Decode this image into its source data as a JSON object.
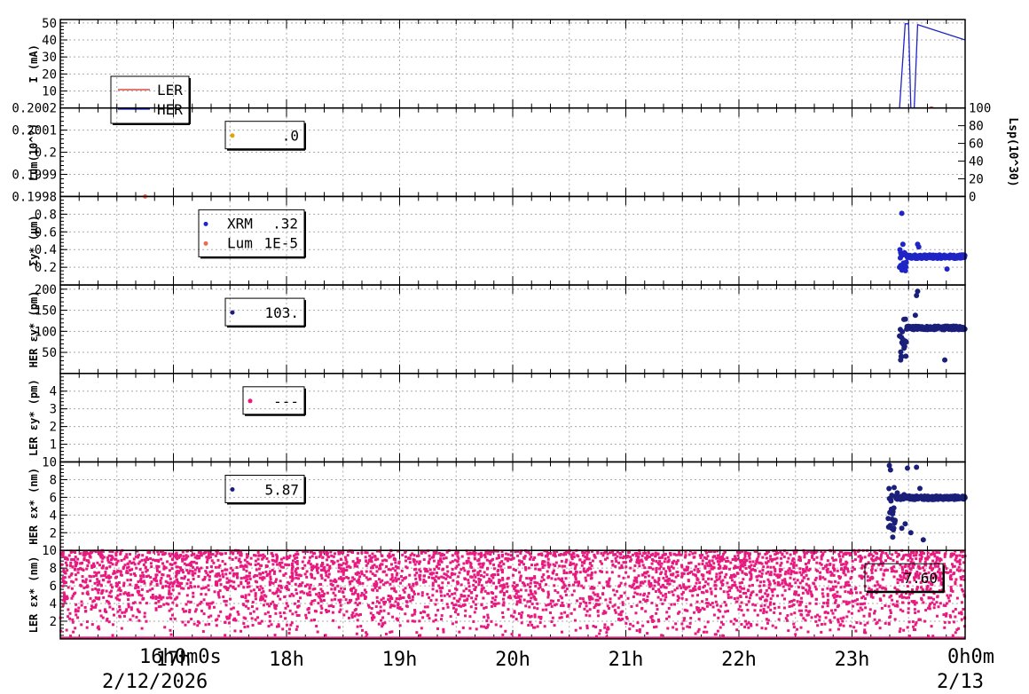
{
  "time_axis": {
    "start_label": "16h0m0s",
    "start_date": "2/12/2026",
    "end_label": "0h0m",
    "end_date": "2/13",
    "ticks": [
      "17h",
      "18h",
      "19h",
      "20h",
      "21h",
      "22h",
      "23h"
    ]
  },
  "chart_data": [
    {
      "id": "current",
      "type": "line",
      "ylabel": "I (mA)",
      "ylim": [
        0,
        52
      ],
      "yticks": [
        "10",
        "20",
        "30",
        "40",
        "50"
      ],
      "legend": [
        {
          "name": "LER",
          "color": "#d62a1e"
        },
        {
          "name": "HER",
          "color": "#1f24c6"
        }
      ],
      "series": [
        {
          "name": "LER",
          "color": "#d62a1e",
          "x": [
            16.0,
            23.68,
            23.7,
            23.73,
            24.0
          ],
          "y": [
            0,
            0,
            0.6,
            0,
            0
          ]
        },
        {
          "name": "HER",
          "color": "#1f24c6",
          "x": [
            16.0,
            23.42,
            23.47,
            23.5,
            23.52,
            23.55,
            23.58,
            24.0
          ],
          "y": [
            0,
            0,
            49.5,
            49.5,
            0,
            0,
            49,
            40
          ]
        }
      ]
    },
    {
      "id": "luminosity",
      "type": "scatter",
      "ylabel": "Lum(10^?)",
      "ylim": [
        0.1998,
        0.2002
      ],
      "yticks": [
        "0.1998",
        "0.1999",
        "0.2",
        "0.2001",
        "0.2002"
      ],
      "y2label": "Lsp(10^30)",
      "y2ticks": [
        "0",
        "20",
        "40",
        "60",
        "80",
        "100"
      ],
      "legend": [
        {
          "value": ".0",
          "color": "#e1a500"
        }
      ]
    },
    {
      "id": "sigma-y",
      "type": "scatter",
      "ylabel": "Σy* (μm)",
      "ylim": [
        0,
        1.0
      ],
      "yticks": [
        "0.2",
        "0.4",
        "0.6",
        "0.8"
      ],
      "legend": [
        {
          "name": "XRM",
          "value": ".32",
          "color": "#1f24c6"
        },
        {
          "name": "Lum",
          "value": "1E-5",
          "color": "#ee6a4c"
        }
      ],
      "series": [
        {
          "name": "XRM",
          "color": "#1f24c6",
          "start": 23.42,
          "end": 24.0,
          "level": 0.32,
          "spikes": [
            [
              23.44,
              0.81
            ],
            [
              23.45,
              0.46
            ],
            [
              23.58,
              0.46
            ],
            [
              23.59,
              0.43
            ],
            [
              23.84,
              0.18
            ],
            [
              23.43,
              0.22
            ],
            [
              23.47,
              0.25
            ]
          ]
        },
        {
          "name": "Lum",
          "color": "#ee6a4c",
          "points": [
            [
              16.75,
              1.0
            ]
          ]
        }
      ]
    },
    {
      "id": "her-ey",
      "type": "scatter",
      "ylabel": "HER εy* (pm)",
      "ylim": [
        0,
        210
      ],
      "yticks": [
        "50",
        "100",
        "150",
        "200"
      ],
      "legend": [
        {
          "value": "103.",
          "color": "#1a1f7a"
        }
      ],
      "series": [
        {
          "name": "HER",
          "color": "#1a1f7a",
          "start": 23.42,
          "end": 24.0,
          "level": 108,
          "spikes": [
            [
              23.58,
              195
            ],
            [
              23.57,
              185
            ],
            [
              23.56,
              138
            ],
            [
              23.43,
              32
            ],
            [
              23.44,
              40
            ],
            [
              23.82,
              32
            ],
            [
              23.45,
              80
            ],
            [
              23.46,
              60
            ]
          ]
        }
      ]
    },
    {
      "id": "ler-ey",
      "type": "scatter",
      "ylabel": "LER εy* (pm)",
      "ylim": [
        0,
        5
      ],
      "yticks": [
        "1",
        "2",
        "3",
        "4"
      ],
      "legend": [
        {
          "value": "---",
          "color": "#e8197f"
        }
      ]
    },
    {
      "id": "her-ex",
      "type": "scatter",
      "ylabel": "HER εx* (nm)",
      "ylim": [
        0,
        10
      ],
      "yticks": [
        "2",
        "4",
        "6",
        "8",
        "10"
      ],
      "legend": [
        {
          "value": "5.87",
          "color": "#1a1f7a"
        }
      ],
      "series": [
        {
          "name": "HER",
          "color": "#1a1f7a",
          "start": 23.32,
          "end": 24.0,
          "level": 5.95,
          "spikes": [
            [
              23.33,
              9.6
            ],
            [
              23.34,
              9.1
            ],
            [
              23.49,
              9.3
            ],
            [
              23.57,
              9.4
            ],
            [
              23.6,
              7.0
            ],
            [
              23.35,
              2.5
            ],
            [
              23.36,
              1.5
            ],
            [
              23.37,
              4.8
            ],
            [
              23.38,
              3.4
            ],
            [
              23.4,
              6.5
            ],
            [
              23.44,
              2.5
            ],
            [
              23.47,
              3.0
            ],
            [
              23.52,
              2.0
            ],
            [
              23.63,
              1.2
            ],
            [
              23.41,
              6.0
            ],
            [
              23.46,
              6.3
            ]
          ]
        }
      ]
    },
    {
      "id": "ler-ex",
      "type": "scatter",
      "ylabel": "LER εx* (nm)",
      "ylim": [
        0,
        10
      ],
      "yticks": [
        "2",
        "4",
        "6",
        "8",
        "10"
      ],
      "legend": [
        {
          "value": "7.60",
          "color": "#e8197f"
        }
      ],
      "series": [
        {
          "name": "LER",
          "color": "#e8197f",
          "start": 16.0,
          "end": 24.0,
          "noise_min": 0,
          "noise_max": 10,
          "density": 4200
        }
      ]
    }
  ]
}
